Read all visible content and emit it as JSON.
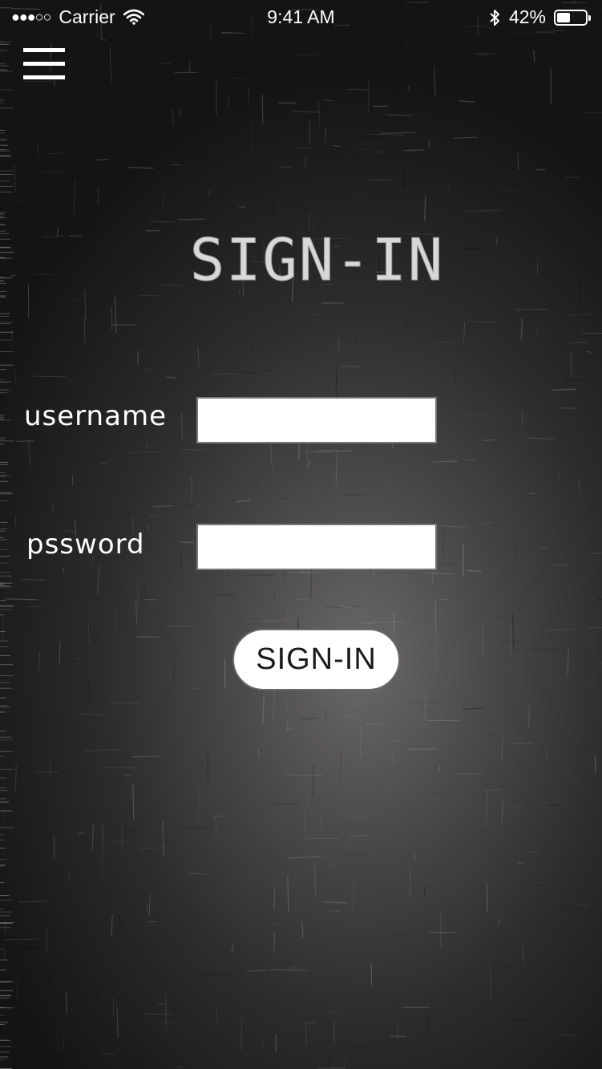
{
  "status_bar": {
    "carrier": "Carrier",
    "time": "9:41 AM",
    "battery_percent": "42%",
    "battery_level": 0.42,
    "signal_dots_filled": "●●●",
    "signal_dots_empty": "○○",
    "icons": [
      "wifi-icon",
      "bluetooth-icon",
      "battery-icon"
    ]
  },
  "header": {
    "menu_icon": "hamburger-menu-icon"
  },
  "main": {
    "title": "SIGN-IN",
    "username_label": "username",
    "password_label": "pssword",
    "username_value": "",
    "password_value": "",
    "submit_label": "SIGN-IN"
  },
  "colors": {
    "background": "#2b2b2b",
    "text": "#ffffff",
    "title": "#d8d8d8",
    "field_bg": "#ffffff",
    "button_text": "#1a1a1a"
  }
}
